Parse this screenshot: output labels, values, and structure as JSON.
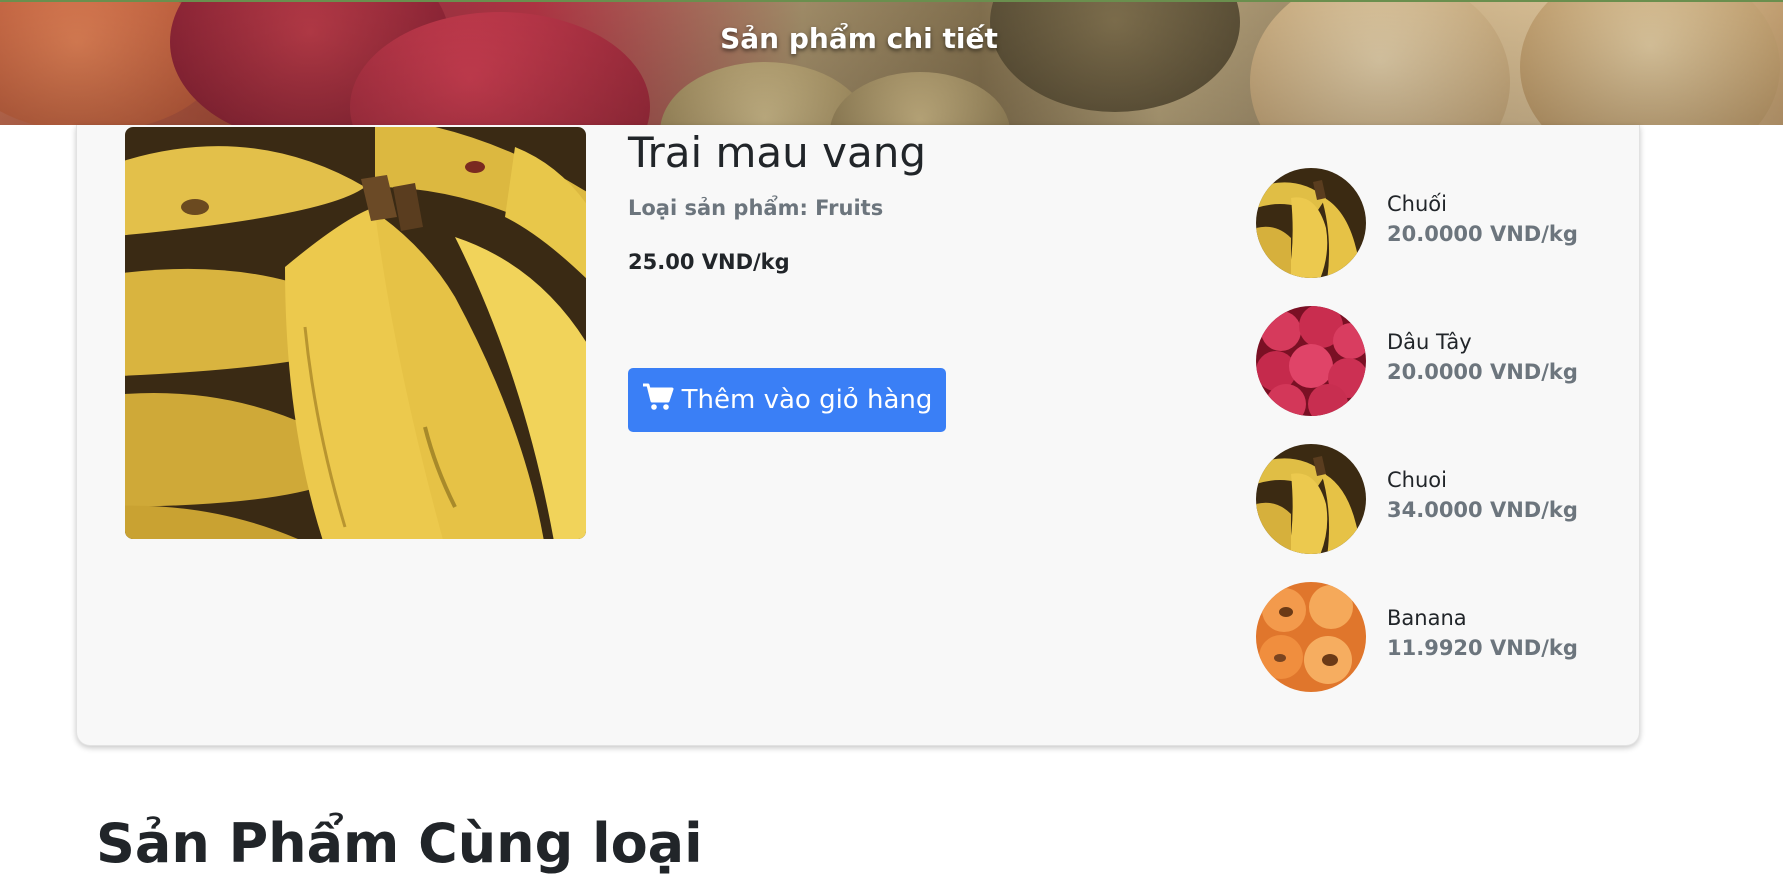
{
  "banner": {
    "title": "Sản phẩm chi tiết"
  },
  "product": {
    "name": "Trai mau vang",
    "category": "Loại sản phẩm: Fruits",
    "price": "25.00 VND/kg",
    "add_to_cart_label": "Thêm vào giỏ hàng",
    "image": "banana-bunch"
  },
  "related": [
    {
      "name": "Chuối",
      "price": "20.0000 VND/kg",
      "image": "banana"
    },
    {
      "name": "Dâu Tây",
      "price": "20.0000 VND/kg",
      "image": "raspberry"
    },
    {
      "name": "Chuoi",
      "price": "34.0000 VND/kg",
      "image": "banana"
    },
    {
      "name": "Banana",
      "price": "11.9920 VND/kg",
      "image": "apricot"
    }
  ],
  "section": {
    "heading": "Sản Phẩm Cùng loại"
  },
  "colors": {
    "primary_button": "#3a7ff6",
    "muted_text": "#6c757d",
    "card_bg": "#f8f8f8"
  },
  "icons": {
    "cart": "shopping-cart-icon"
  }
}
